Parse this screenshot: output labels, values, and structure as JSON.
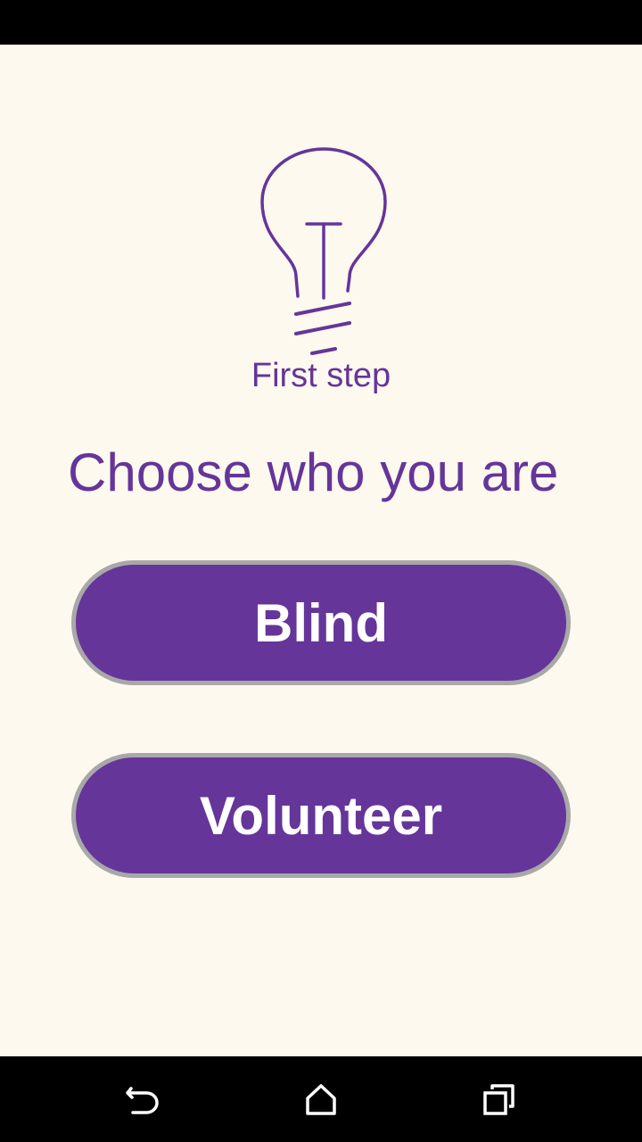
{
  "status_bar": {},
  "hero": {
    "icon": "lightbulb-icon",
    "caption": "First step"
  },
  "prompt": "Choose who you are",
  "choices": {
    "blind_label": "Blind",
    "volunteer_label": "Volunteer"
  },
  "nav_bar": {
    "back_icon": "back-icon",
    "home_icon": "home-icon",
    "recents_icon": "recents-icon"
  },
  "colors": {
    "accent": "#65359a",
    "background": "#fdf9ee",
    "button_border": "#a8a8a8"
  }
}
